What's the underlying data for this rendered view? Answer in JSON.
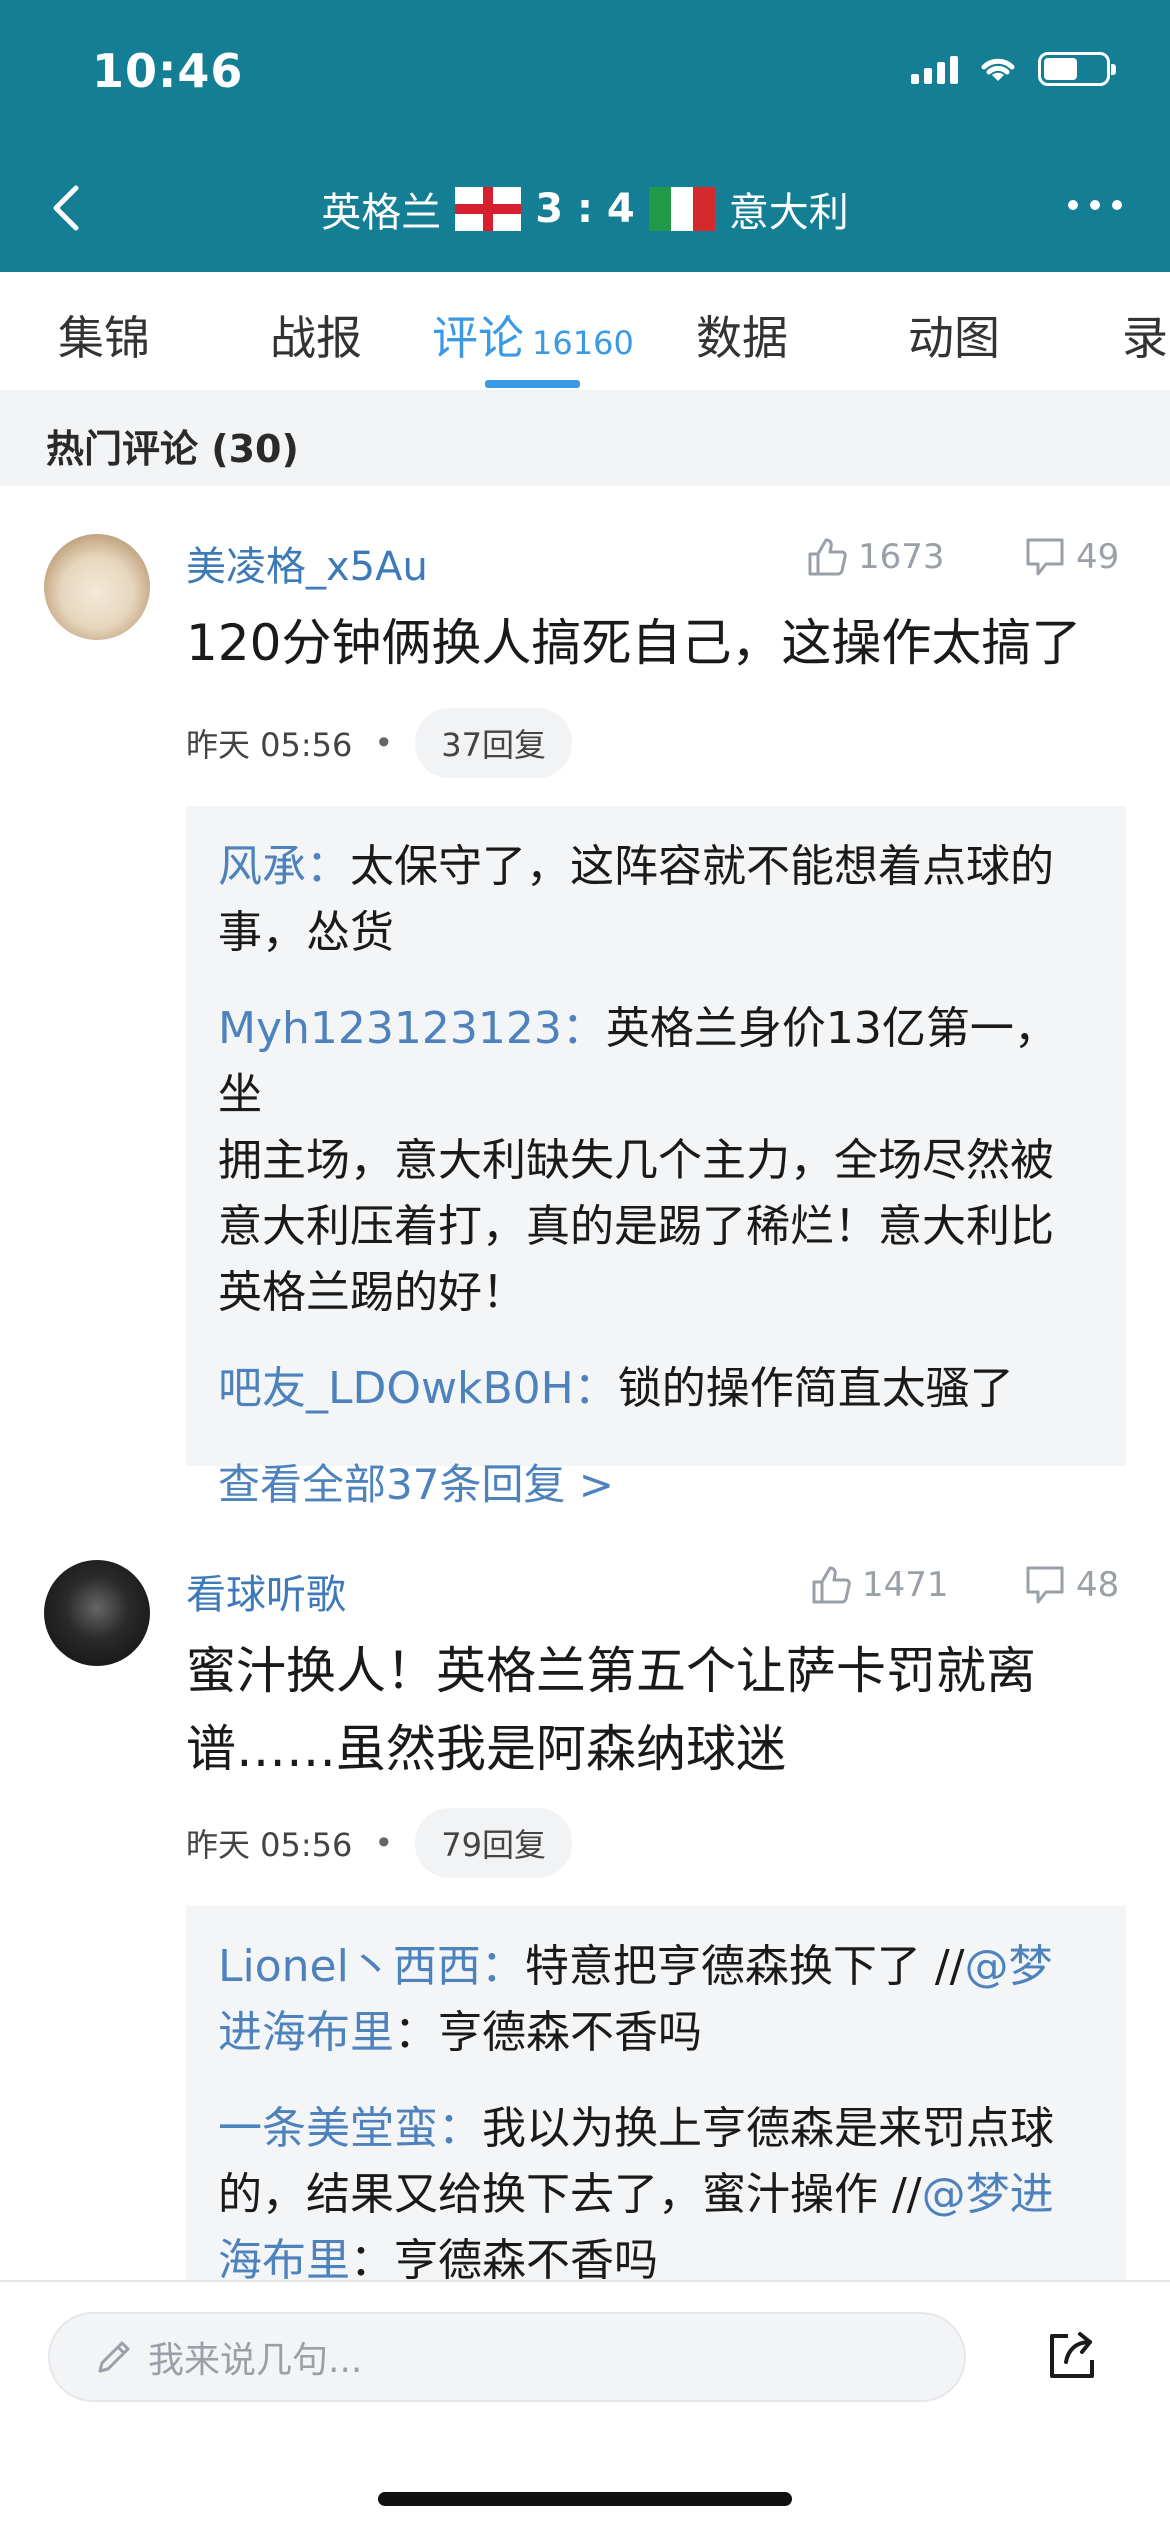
{
  "status_bar": {
    "time": "10:46"
  },
  "nav": {
    "team_home": "英格兰",
    "score": "3 : 4",
    "team_away": "意大利"
  },
  "tabs": [
    {
      "label": "集锦"
    },
    {
      "label": "战报"
    },
    {
      "label": "评论",
      "count": "16160",
      "active": true
    },
    {
      "label": "数据"
    },
    {
      "label": "动图"
    },
    {
      "label": "录"
    }
  ],
  "section": {
    "title": "热门评论 (30)"
  },
  "comments": [
    {
      "username": "美凌格_x5Au",
      "likes": "1673",
      "dislikes": "49",
      "text_lines": [
        "120分钟俩换人搞死自己，这操作太搞了"
      ],
      "time": "昨天 05:56",
      "replies_count": "37回复",
      "replies": [
        {
          "user": "风承：",
          "lines": [
            "太保守了，这阵容就不能想着点球的",
            "事，怂货"
          ]
        },
        {
          "user": "Myh123123123：",
          "lines": [
            "英格兰身价13亿第一，坐",
            "拥主场，意大利缺失几个主力，全场尽然被",
            "意大利压着打，真的是踢了稀烂！意大利比",
            "英格兰踢的好！"
          ]
        },
        {
          "user": "吧友_LDOwkB0H：",
          "lines": [
            "锁的操作简直太骚了"
          ]
        }
      ],
      "view_all": "查看全部37条回复 >"
    },
    {
      "username": "看球听歌",
      "likes": "1471",
      "dislikes": "48",
      "text_lines": [
        "蜜汁换人！英格兰第五个让萨卡罚就离",
        "谱……虽然我是阿森纳球迷"
      ],
      "time": "昨天 05:56",
      "replies_count": "79回复",
      "replies": [
        {
          "user": "Lionel丶西西：",
          "line1": "特意把亨德森换下了 //",
          "at1": "@梦",
          "at2": "进海布里",
          "line2": "：亨德森不香吗"
        },
        {
          "user": "一条美堂蛮：",
          "line1": "我以为换上亨德森是来罚点球",
          "line2": "的，结果又给换下去了，蜜汁操作 //",
          "at1": "@梦进",
          "at2": "海布里",
          "line3": "：亨德森不香吗"
        }
      ]
    }
  ],
  "bottom_bar": {
    "input_placeholder": "我来说几句..."
  },
  "colors": {
    "header_bg": "#147e94",
    "accent": "#3b9ae6",
    "username": "#3f7ab8",
    "reply_user": "#4d82bd"
  }
}
